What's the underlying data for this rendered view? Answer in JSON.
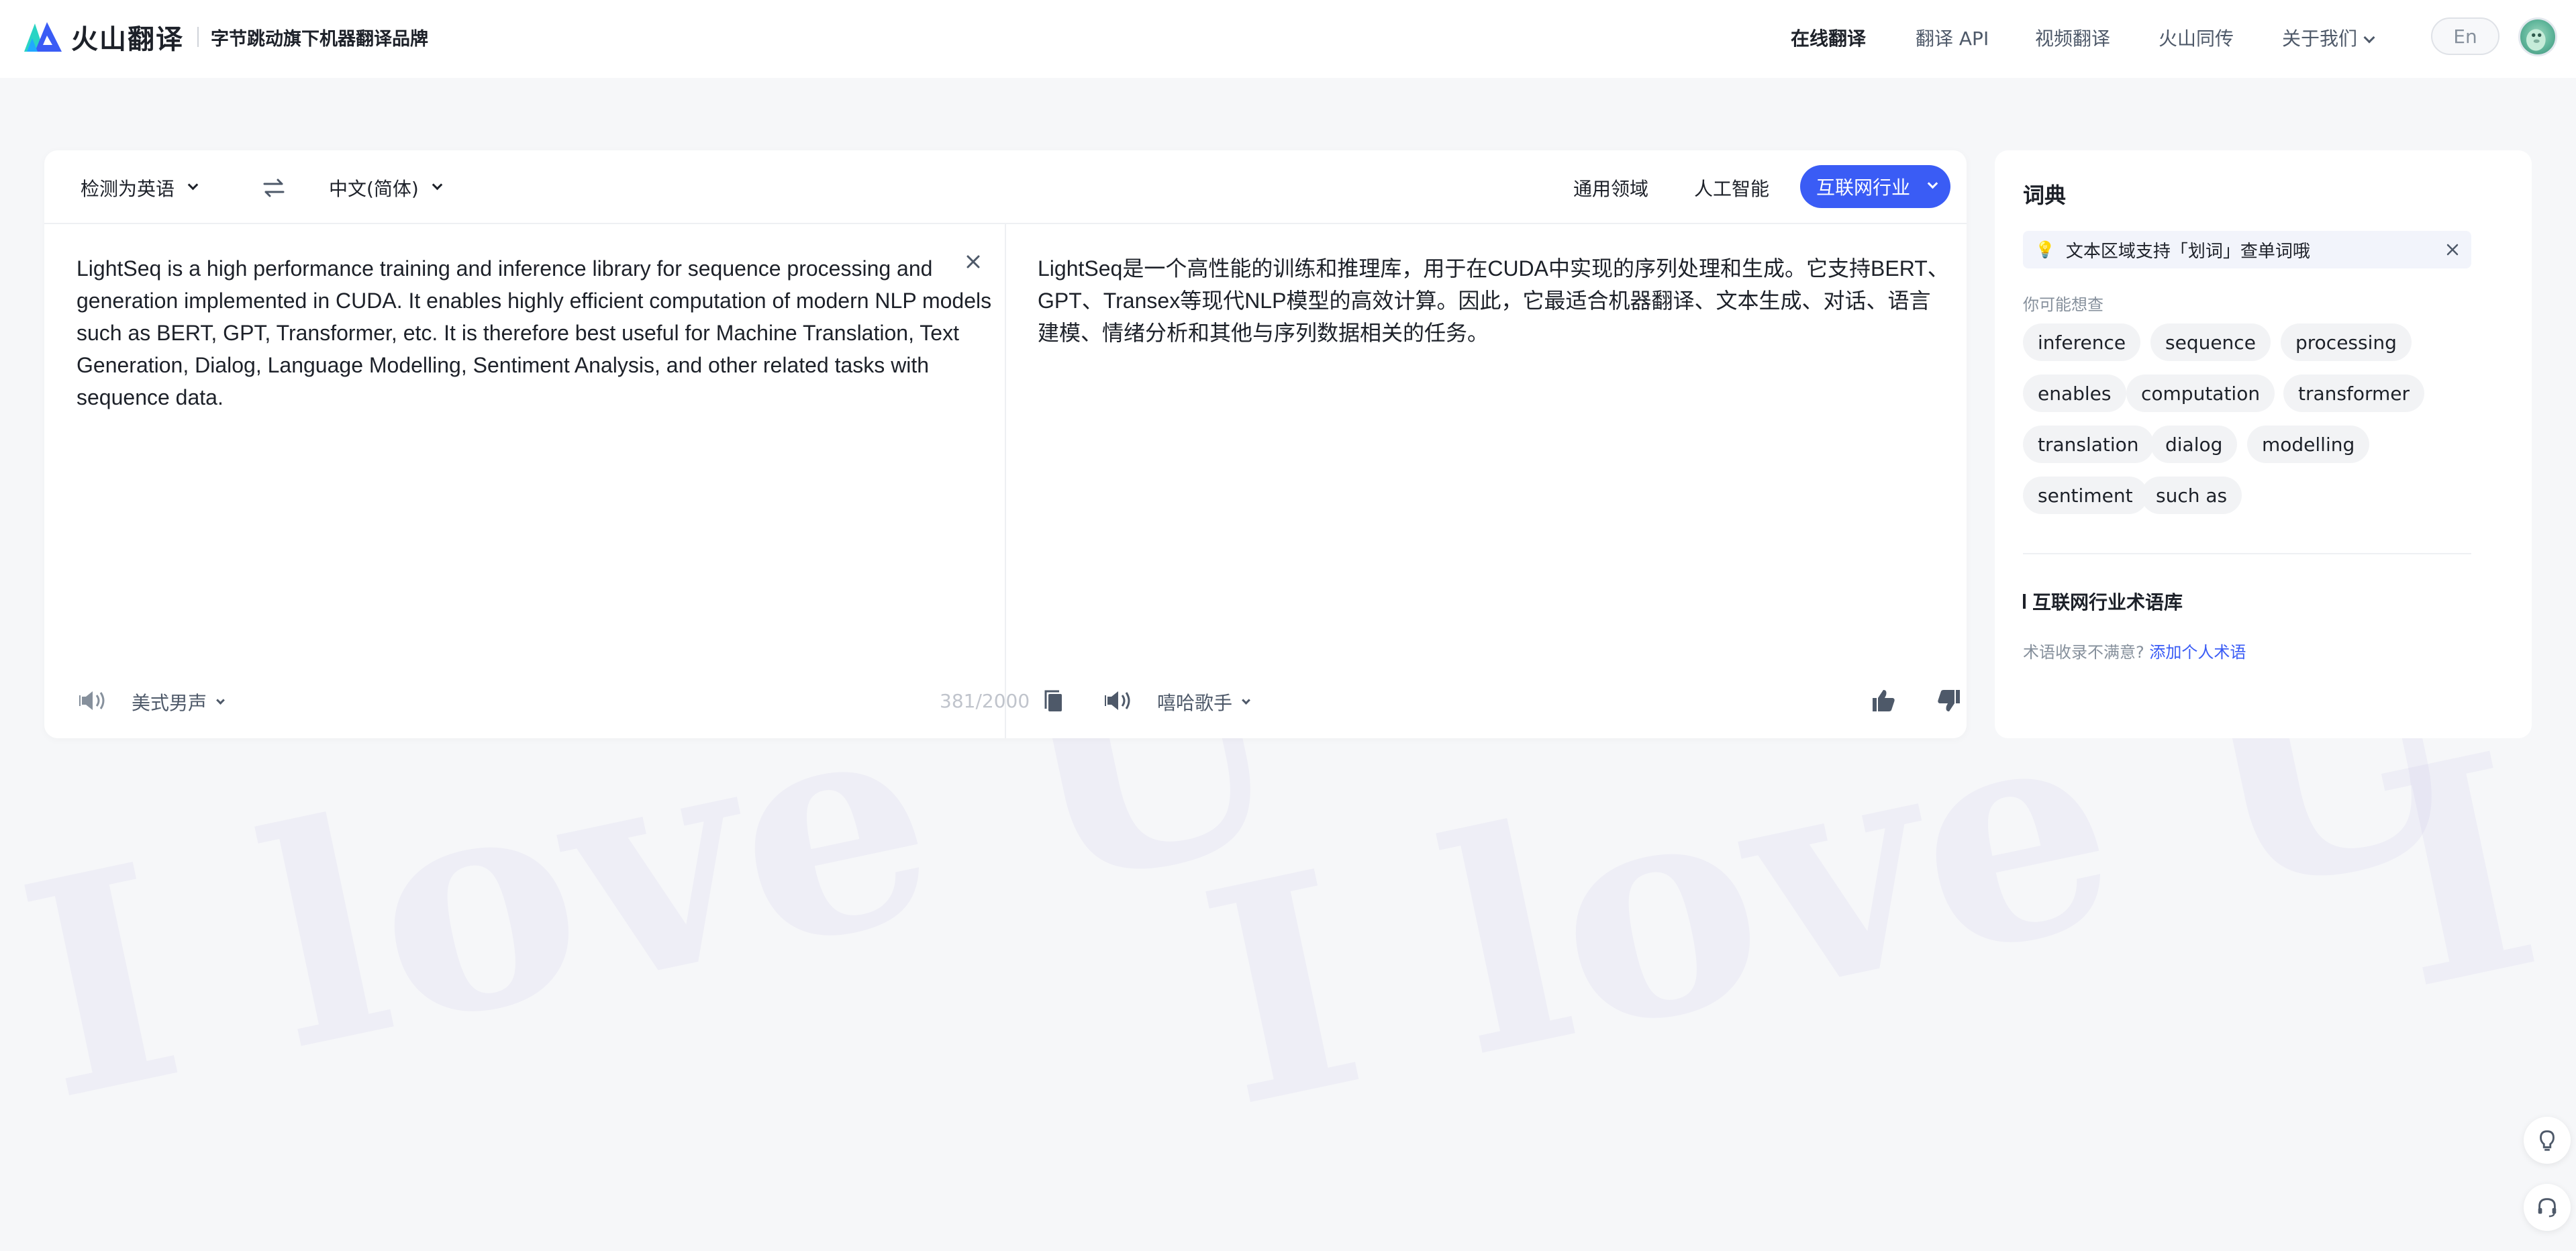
{
  "watermark": {
    "text_1": "I love U",
    "text_2": "I love U",
    "text_3": "I"
  },
  "header": {
    "logo_text": "火山翻译",
    "slogan": "字节跳动旗下机器翻译品牌",
    "nav": {
      "online": "在线翻译",
      "api": "翻译 API",
      "video": "视频翻译",
      "simul": "火山同传",
      "about": "关于我们"
    },
    "lang_button": "En"
  },
  "translator": {
    "source_lang": "检测为英语",
    "target_lang": "中文(简体)",
    "domains": {
      "general": "通用领域",
      "ai": "人工智能",
      "internet": "互联网行业"
    },
    "source_text": "LightSeq is a high performance training and inference library for sequence processing and generation implemented in CUDA. It enables highly efficient computation of modern NLP models such as BERT, GPT, Transformer, etc. It is therefore best useful for Machine Translation, Text Generation, Dialog, Language Modelling, Sentiment Analysis, and other related tasks with sequence data.",
    "target_text": "LightSeq是一个高性能的训练和推理库，用于在CUDA中实现的序列处理和生成。它支持BERT、GPT、Transex等现代NLP模型的高效计算。因此，它最适合机器翻译、文本生成、对话、语言建模、情绪分析和其他与序列数据相关的任务。",
    "source_voice": "美式男声",
    "char_count": "381/2000",
    "target_voice": "嘻哈歌手"
  },
  "dictionary": {
    "title": "词典",
    "tip": "文本区域支持「划词」查单词哦",
    "suggest_label": "你可能想查",
    "words": [
      "inference",
      "sequence",
      "processing",
      "enables",
      "computation",
      "transformer",
      "translation",
      "dialog",
      "modelling",
      "sentiment",
      "such as"
    ],
    "term_title": "互联网行业术语库",
    "term_hint": "术语收录不满意?",
    "term_link": "添加个人术语"
  },
  "colors": {
    "accent": "#3a5cf5",
    "background": "#f6f7f9",
    "text": "#1d2129",
    "muted": "#86909c"
  },
  "icons": [
    "logo-icon",
    "swap-icon",
    "clear-icon",
    "speaker-icon",
    "copy-icon",
    "thumb-up-icon",
    "thumb-down-icon",
    "bulb-icon",
    "close-icon",
    "dictionary-icon",
    "history-icon",
    "favorite-icon",
    "settings-icon",
    "chevron-right-icon",
    "lightbulb-icon",
    "headset-icon"
  ]
}
